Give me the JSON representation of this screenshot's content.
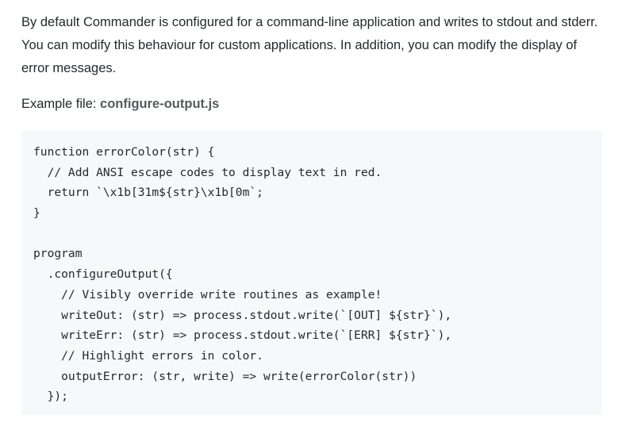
{
  "intro": {
    "paragraph": "By default Commander is configured for a command-line application and writes to stdout and stderr. You can modify this behaviour for custom applications. In addition, you can modify the display of error messages.",
    "example_prefix": "Example file: ",
    "example_file": "configure-output.js"
  },
  "code": {
    "language": "javascript",
    "lines": [
      "function errorColor(str) {",
      "  // Add ANSI escape codes to display text in red.",
      "  return `\\x1b[31m${str}\\x1b[0m`;",
      "}",
      "",
      "program",
      "  .configureOutput({",
      "    // Visibly override write routines as example!",
      "    writeOut: (str) => process.stdout.write(`[OUT] ${str}`),",
      "    writeErr: (str) => process.stdout.write(`[ERR] ${str}`),",
      "    // Highlight errors in color.",
      "    outputError: (str, write) => write(errorColor(str))",
      "  });"
    ]
  }
}
